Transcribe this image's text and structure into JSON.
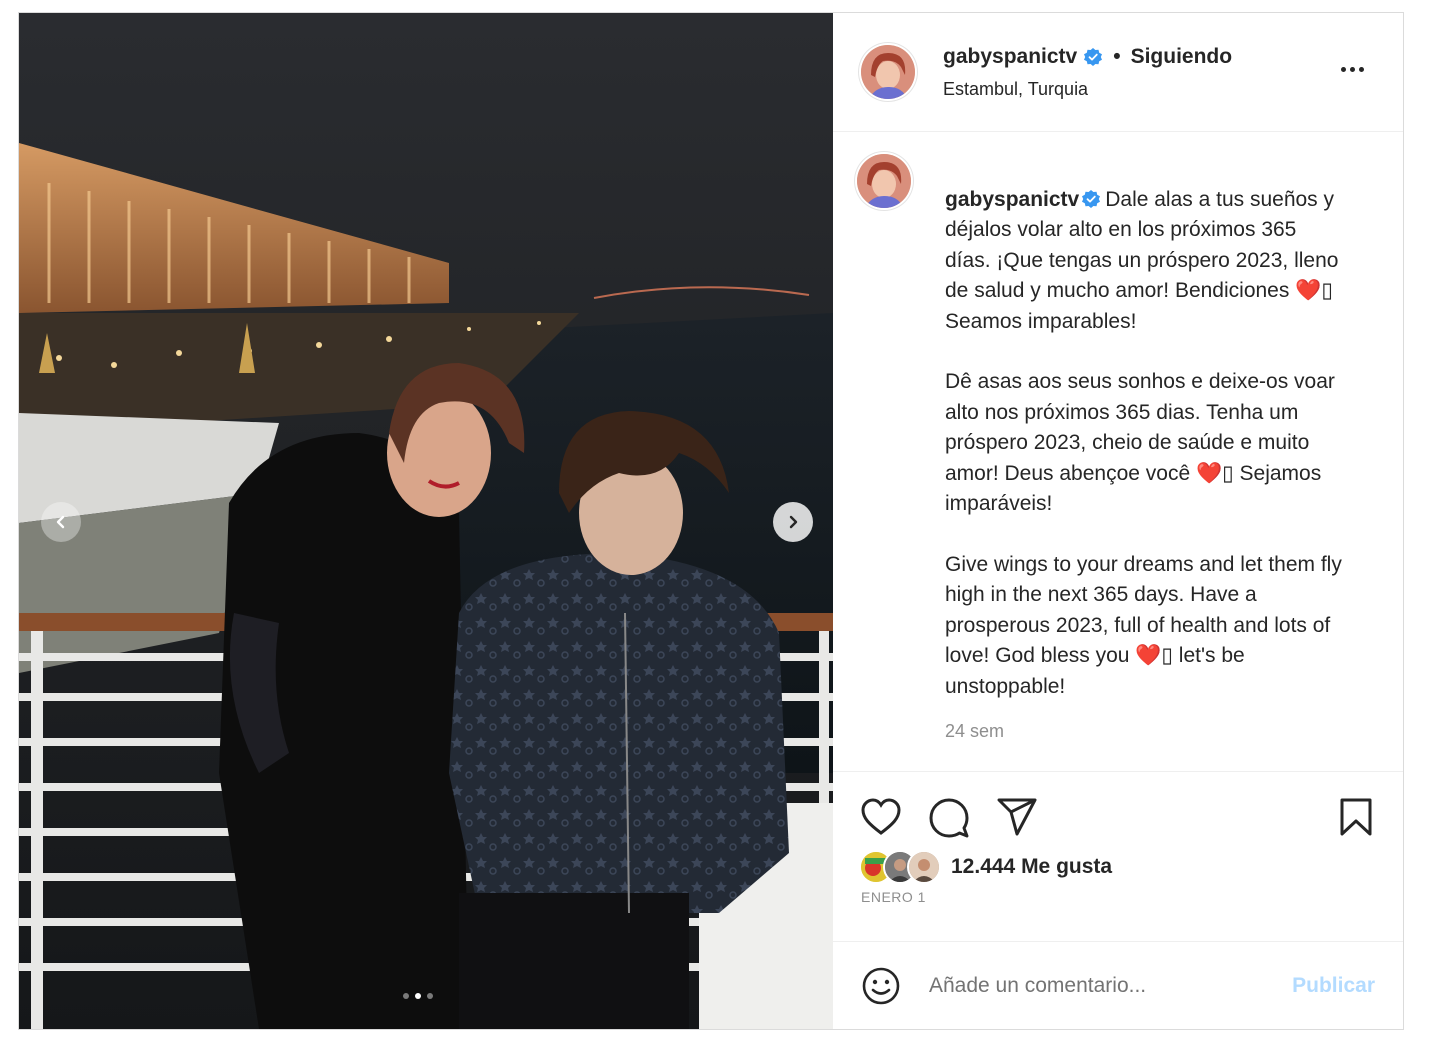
{
  "post": {
    "username": "gabyspanictv",
    "separator": "•",
    "follow_status": "Siguiendo",
    "location": "Estambul, Turquia",
    "more_icon": "more-horizontal-icon",
    "verified_color": "#3897f0",
    "carousel": {
      "dots": 3,
      "active_index": 1
    }
  },
  "caption": {
    "username": "gabyspanictv",
    "paragraphs": [
      "Dale alas a tus sueños y déjalos volar alto en los próximos 365 días. ¡Que tengas un próspero 2023, lleno de salud y mucho amor! Bendiciones ❤️▯ Seamos imparables!",
      "Dê asas aos seus sonhos e deixe-os voar alto nos próximos 365 dias. Tenha um próspero 2023, cheio de saúde e muito amor! Deus abençoe você ❤️▯ Sejamos imparáveis!",
      "Give wings to your dreams and let them fly high in the next 365 days. Have a prosperous 2023, full of health and lots of love! God bless you ❤️▯ let's be unstoppable!"
    ],
    "time_ago": "24 sem"
  },
  "actions": {
    "icons": [
      "heart-icon",
      "comment-icon",
      "share-icon",
      "bookmark-icon"
    ],
    "likes": "12.444 Me gusta",
    "date": "ENERO 1"
  },
  "comment": {
    "placeholder": "Añade un comentario...",
    "publish_label": "Publicar",
    "publish_color": "#b3dbff"
  }
}
